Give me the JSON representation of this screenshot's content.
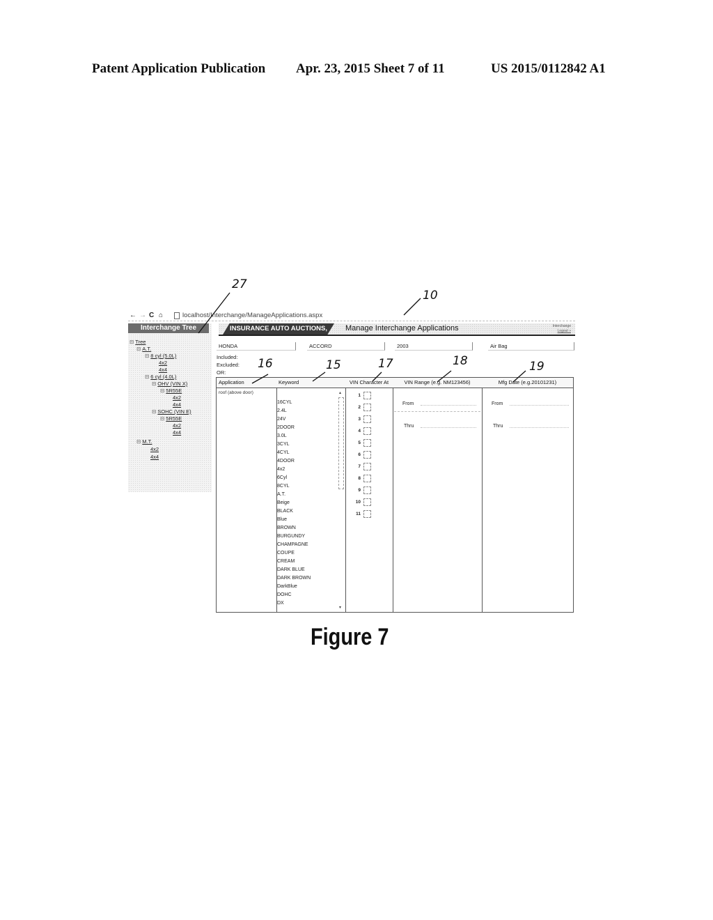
{
  "patent_header": {
    "left": "Patent Application Publication",
    "middle": "Apr. 23, 2015  Sheet 7 of 11",
    "right": "US 2015/0112842 A1"
  },
  "browser": {
    "back_icon": "←",
    "forward_icon": "→",
    "reload_icon": "C",
    "home_icon": "⌂",
    "url": "localhost/Interchange/ManageApplications.aspx"
  },
  "tree_panel": {
    "header": "Interchange Tree",
    "nodes": [
      {
        "toggle": "⊟",
        "label": "Tree"
      },
      {
        "toggle": "⊟",
        "label": "A.T."
      },
      {
        "toggle": "⊟",
        "label": "8 cyl (5.0L)"
      },
      {
        "toggle": "",
        "label": "4x2"
      },
      {
        "toggle": "",
        "label": "4x4"
      },
      {
        "toggle": "⊟",
        "label": "6 cyl (4.0L)"
      },
      {
        "toggle": "⊟",
        "label": "OHV (VIN X)"
      },
      {
        "toggle": "⊟",
        "label": "5R55E"
      },
      {
        "toggle": "",
        "label": "4x2"
      },
      {
        "toggle": "",
        "label": "4x4"
      },
      {
        "toggle": "⊟",
        "label": "SOHC (VIN E)"
      },
      {
        "toggle": "⊟",
        "label": "5R55E"
      },
      {
        "toggle": "",
        "label": "4x2"
      },
      {
        "toggle": "",
        "label": "4x4"
      },
      {
        "toggle": "⊟",
        "label": "M.T."
      },
      {
        "toggle": "",
        "label": "4x2"
      },
      {
        "toggle": "",
        "label": "4x4"
      }
    ]
  },
  "brand_bar": {
    "brand": "INSURANCE AUTO AUCTIONS, INC.",
    "title": "Manage Interchange Applications",
    "link_top": "Interchange",
    "link_logout": "Logout »"
  },
  "filters": {
    "make": "HONDA",
    "model": "ACCORD",
    "year": "2003",
    "part": "Air Bag",
    "included_label": "Included:",
    "excluded_label": "Excluded:",
    "or_label": "OR:"
  },
  "grid": {
    "headers": {
      "application": "Application",
      "keyword": "Keyword",
      "vin_char": "VIN Character At",
      "vin_range": "VIN Range (e.g. NM123456)",
      "mfg_date": "Mfg Date (e.g.20101231)"
    },
    "application_item": "roof (above door)",
    "keywords": [
      "16CYL",
      "2.4L",
      "24V",
      "2DOOR",
      "3.0L",
      "3CYL",
      "4CYL",
      "4DOOR",
      "4x2",
      "6Cyl",
      "8CYL",
      "A.T.",
      "Beige",
      "BLACK",
      "Blue",
      "BROWN",
      "BURGUNDY",
      "CHAMPAGNE",
      "COUPE",
      "CREAM",
      "DARK BLUE",
      "DARK BROWN",
      "DarkBlue",
      "DOHC",
      "DX"
    ],
    "scroll_up": "▴",
    "scroll_down": "▾",
    "vin_positions": [
      "1",
      "2",
      "3",
      "4",
      "5",
      "6",
      "7",
      "8",
      "9",
      "10",
      "11"
    ],
    "from_label": "From",
    "thru_label": "Thru"
  },
  "callouts": {
    "c27": "27",
    "c10": "10",
    "c16": "16",
    "c15": "15",
    "c17": "17",
    "c18": "18",
    "c19": "19"
  },
  "figure_caption": "Figure 7"
}
